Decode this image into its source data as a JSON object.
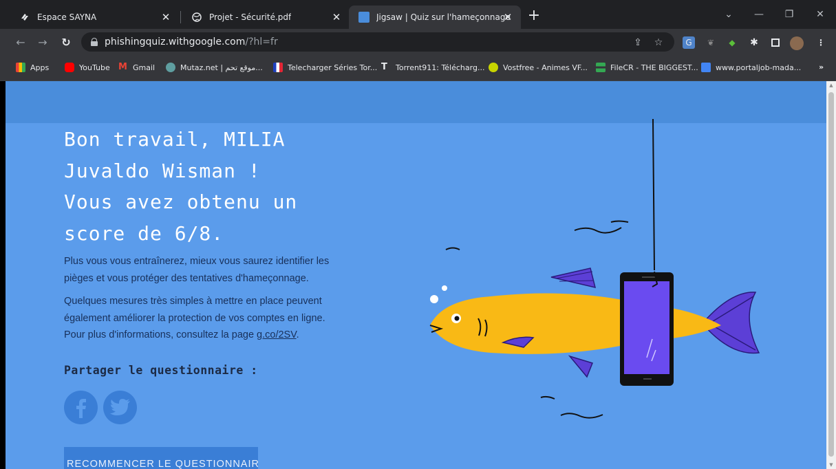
{
  "tabs": [
    {
      "title": "Espace SAYNA",
      "icon": "sayna-icon"
    },
    {
      "title": "Projet - Sécurité.pdf",
      "icon": "globe-icon"
    },
    {
      "title": "Jigsaw | Quiz sur l'hameçonnage",
      "icon": "jigsaw-icon",
      "active": true
    }
  ],
  "address": {
    "host": "phishingquiz.withgoogle.com",
    "path": "/?hl=fr"
  },
  "bookmarks": [
    {
      "label": "Apps",
      "icon": "apps-grid-icon",
      "color": "#fbbc04"
    },
    {
      "label": "YouTube",
      "icon": "youtube-icon",
      "color": "#ff0000"
    },
    {
      "label": "Gmail",
      "icon": "gmail-icon",
      "color": "#ea4335"
    },
    {
      "label": "Mutaz.net | موقع تحم...",
      "icon": "mutaz-icon",
      "color": "#5f9ea0"
    },
    {
      "label": "Telecharger Séries Tor...",
      "icon": "flag-icon",
      "color": "#1e3fbf"
    },
    {
      "label": "Torrent911: Télécharg...",
      "icon": "torrent-icon",
      "color": "#e8eaed"
    },
    {
      "label": "Vostfree - Animes VF...",
      "icon": "vostfree-icon",
      "color": "#c8d400"
    },
    {
      "label": "FileCR - THE BIGGEST...",
      "icon": "filecr-icon",
      "color": "#34a853"
    },
    {
      "label": "www.portaljob-mada...",
      "icon": "portaljob-icon",
      "color": "#4285f4"
    }
  ],
  "bookmarks_more": "»",
  "quiz": {
    "headline_1": "Bon travail, MILIA",
    "headline_2": "Juvaldo Wisman !",
    "headline_3": "Vous avez obtenu un",
    "headline_4": "score de 6/8.",
    "para1_line1": "Plus vous vous entraînerez, mieux vous saurez identifier les",
    "para1_line2": "pièges et vous protéger des tentatives d'hameçonnage.",
    "para2_line1": "Quelques mesures très simples à mettre en place peuvent",
    "para2_line2": "également améliorer la protection de vos comptes en ligne.",
    "para2_line3": "Pour plus d'informations, consultez la page ",
    "para2_link": "g.co/2SV",
    "para2_end": ".",
    "share_title": "Partager le questionnaire :",
    "restart_label": "RECOMMENCER LE QUESTIONNAIRE"
  },
  "colors": {
    "page_bg": "#5b9ceb",
    "fish_body": "#f9b915",
    "fish_fins": "#5c3fd6",
    "phone_screen": "#6a4bf0"
  }
}
